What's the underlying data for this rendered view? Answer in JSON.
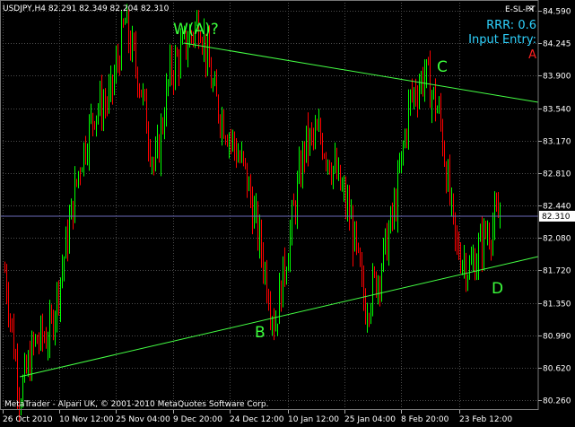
{
  "header": {
    "symbol_line": "USDJPY,H4  82.291 82.349 82.204 82.310",
    "panel_title": "E-SL-PT",
    "close_glyph": "×",
    "rrr_label": "RRR: 0.6",
    "input_entry_label": "Input Entry:",
    "entry_marker": "A"
  },
  "price_axis": {
    "ticks": [
      "84.590",
      "84.245",
      "83.900",
      "83.540",
      "83.170",
      "82.810",
      "82.440",
      "82.080",
      "81.720",
      "81.350",
      "80.990",
      "80.620",
      "80.260",
      "79.900"
    ],
    "current_price": "82.310"
  },
  "time_axis": {
    "ticks": [
      "26 Oct 2010",
      "10 Nov 12:00",
      "25 Nov 04:00",
      "9 Dec 20:00",
      "24 Dec 12:00",
      "10 Jan 12:00",
      "25 Jan 04:00",
      "8 Feb 20:00",
      "23 Feb 12:00"
    ]
  },
  "wave_labels": {
    "wa": "W(A)?",
    "b": "B",
    "c": "C",
    "d": "D"
  },
  "footer": {
    "copyright": "MetaTrader - Alpari UK, © 2001-2010 MetaQuotes Software Corp."
  },
  "colors": {
    "background": "#000000",
    "grid": "#4d4d4d",
    "bull": "#00ff00",
    "bear": "#ff0000",
    "trendline": "#44ff44",
    "bid_line": "#6a6ab8",
    "panel_text": "#2fd3ff",
    "entry_marker": "#ff2020"
  },
  "chart_data": {
    "type": "candlestick",
    "symbol": "USDJPY",
    "timeframe": "H4",
    "bar_ohlc": {
      "open": 82.291,
      "high": 82.349,
      "low": 82.204,
      "close": 82.31
    },
    "ylim": [
      79.9,
      84.75
    ],
    "path_close": [
      {
        "x": "26 Oct 2010",
        "y": 81.7
      },
      {
        "x": "28 Oct",
        "y": 80.3
      },
      {
        "x": "1 Nov",
        "y": 80.9
      },
      {
        "x": "5 Nov",
        "y": 81.0
      },
      {
        "x": "8 Nov",
        "y": 81.9
      },
      {
        "x": "10 Nov 12:00",
        "y": 82.9
      },
      {
        "x": "14 Nov",
        "y": 83.5
      },
      {
        "x": "18 Nov",
        "y": 83.6
      },
      {
        "x": "21 Nov",
        "y": 84.45
      },
      {
        "x": "25 Nov 04:00",
        "y": 83.8
      },
      {
        "x": "28 Nov",
        "y": 82.8
      },
      {
        "x": "1 Dec",
        "y": 83.9
      },
      {
        "x": "5 Dec",
        "y": 84.2
      },
      {
        "x": "8 Dec",
        "y": 84.5
      },
      {
        "x": "12 Dec",
        "y": 83.6
      },
      {
        "x": "17 Dec",
        "y": 83.2
      },
      {
        "x": "20 Dec",
        "y": 82.8
      },
      {
        "x": "24 Dec 12:00",
        "y": 82.0
      },
      {
        "x": "27 Dec",
        "y": 81.1
      },
      {
        "x": "31 Dec",
        "y": 82.1
      },
      {
        "x": "4 Jan",
        "y": 83.1
      },
      {
        "x": "8 Jan",
        "y": 83.2
      },
      {
        "x": "12 Jan",
        "y": 82.8
      },
      {
        "x": "18 Jan",
        "y": 82.3
      },
      {
        "x": "25 Jan 04:00",
        "y": 81.3
      },
      {
        "x": "29 Jan",
        "y": 81.7
      },
      {
        "x": "2 Feb",
        "y": 82.4
      },
      {
        "x": "7 Feb",
        "y": 83.6
      },
      {
        "x": "10 Feb",
        "y": 83.9
      },
      {
        "x": "15 Feb",
        "y": 83.4
      },
      {
        "x": "19 Feb",
        "y": 82.0
      },
      {
        "x": "22 Feb",
        "y": 81.7
      },
      {
        "x": "24 Feb",
        "y": 82.1
      },
      {
        "x": "26 Feb",
        "y": 82.31
      }
    ],
    "trendlines": [
      {
        "name": "upper",
        "from": {
          "x": "9 Dec 20:00",
          "y": 84.6
        },
        "to": {
          "x": "1 Mar",
          "y": 83.7
        }
      },
      {
        "name": "lower",
        "from": {
          "x": "26 Oct 2010",
          "y": 80.26
        },
        "to": {
          "x": "1 Mar",
          "y": 81.75
        }
      }
    ],
    "wave_points": [
      {
        "label": "W(A)?",
        "x": "9 Dec",
        "y": 84.6
      },
      {
        "label": "B",
        "x": "28 Dec",
        "y": 81.0
      },
      {
        "label": "C",
        "x": "10 Feb",
        "y": 83.95
      },
      {
        "label": "D",
        "x": "24 Feb",
        "y": 81.6
      }
    ]
  }
}
